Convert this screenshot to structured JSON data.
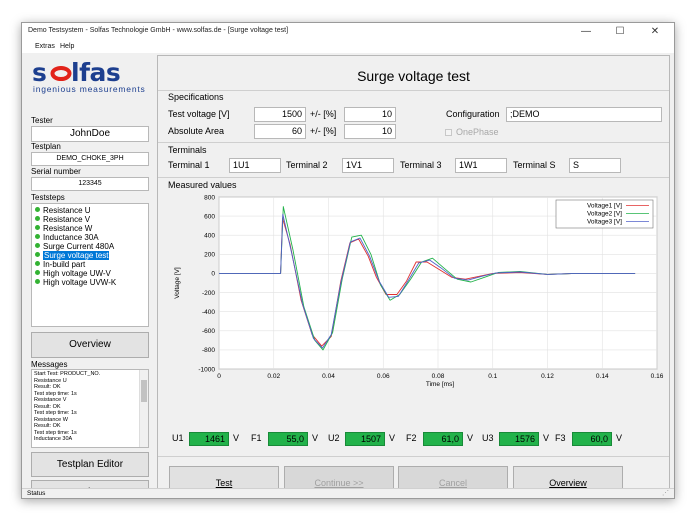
{
  "window": {
    "title": "Demo Testsystem - Solfas Technologie GmbH - www.solfas.de - [Surge voltage test]",
    "min_glyph": "—",
    "max_glyph": "☐",
    "close_glyph": "✕"
  },
  "menu": {
    "items": [
      "Extras",
      "Help"
    ]
  },
  "logo": {
    "brand": "solfas",
    "tagline": "ingenious measurements"
  },
  "tester": {
    "label": "Tester",
    "value": "JohnDoe"
  },
  "testplan": {
    "label": "Testplan",
    "value": "DEMO_CHOKE_3PH"
  },
  "serial": {
    "label": "Serial number",
    "value": "123345"
  },
  "teststeps": {
    "label": "Teststeps",
    "items": [
      "Resistance U",
      "Resistance V",
      "Resistance W",
      "Inductance 30A",
      "Surge Current 480A",
      "Surge voltage test",
      "In-build part",
      "High voltage UW-V",
      "High voltage UVW-K"
    ],
    "selected_index": 5
  },
  "overview_side_label": "Overview",
  "messages": {
    "label": "Messages",
    "lines": [
      "Start Test: PRODUCT_NO.",
      "Resistance U",
      "Result: OK",
      "Test step time: 1s",
      "Resistance V",
      "Result: OK",
      "Test step time: 1s",
      "Resistance W",
      "Result: OK",
      "Test step time: 1s",
      "Inductance 30A"
    ]
  },
  "side_buttons": {
    "testplan_editor": "Testplan Editor",
    "hardcopy": "Hardcopy"
  },
  "status": "Status",
  "main": {
    "title": "Surge voltage test",
    "specs": {
      "label": "Specifications",
      "test_voltage_label": "Test voltage [V]",
      "test_voltage_value": "1500",
      "tol_label_1": "+/- [%]",
      "tol_value_1": "10",
      "absolute_area_label": "Absolute Area",
      "absolute_area_value": "60",
      "tol_label_2": "+/- [%]",
      "tol_value_2": "10",
      "configuration_label": "Configuration",
      "configuration_value": ";DEMO",
      "onephase_label": "OnePhase",
      "onephase_checked": false
    },
    "terminals": {
      "label": "Terminals",
      "items": [
        {
          "label": "Terminal 1",
          "value": "1U1"
        },
        {
          "label": "Terminal 2",
          "value": "1V1"
        },
        {
          "label": "Terminal 3",
          "value": "1W1"
        },
        {
          "label": "Terminal S",
          "value": "S"
        }
      ]
    },
    "measured_label": "Measured values",
    "results": [
      {
        "label": "U1",
        "value": "1461",
        "unit": "V"
      },
      {
        "label": "F1",
        "value": "55,0",
        "unit": "V"
      },
      {
        "label": "U2",
        "value": "1507",
        "unit": "V"
      },
      {
        "label": "F2",
        "value": "61,0",
        "unit": "V"
      },
      {
        "label": "U3",
        "value": "1576",
        "unit": "V"
      },
      {
        "label": "F3",
        "value": "60,0",
        "unit": "V"
      }
    ],
    "buttons": [
      {
        "label": "Test",
        "enabled": true
      },
      {
        "label": "Continue >>",
        "enabled": false
      },
      {
        "label": "Cancel",
        "enabled": false
      },
      {
        "label": "Overview",
        "enabled": true
      }
    ]
  },
  "colors": {
    "logo_blue": "#1d3f8f",
    "logo_red": "#e2231a",
    "result_green": "#22b24a",
    "selection_blue": "#0078d7",
    "series1": "#e03030",
    "series2": "#22b24a",
    "series3": "#5060c8"
  },
  "chart_data": {
    "type": "line",
    "xlabel": "Time [ms]",
    "ylabel": "Voltage [V]",
    "xlim": [
      0,
      0.16
    ],
    "ylim": [
      -1000,
      800
    ],
    "xticks": [
      "0",
      "0.02",
      "0.04",
      "0.06",
      "0.08",
      "0.1",
      "0.12",
      "0.14",
      "0.16"
    ],
    "yticks": [
      "800",
      "600",
      "400",
      "200",
      "0",
      "-200",
      "-400",
      "-600",
      "-800",
      "-1000"
    ],
    "grid": true,
    "legend_position": "top-right",
    "series": [
      {
        "name": "Voltage1 [V]",
        "color": "#e03030",
        "x": [
          0,
          0.021,
          0.0225,
          0.0232,
          0.026,
          0.03,
          0.034,
          0.0375,
          0.041,
          0.0445,
          0.0478,
          0.051,
          0.0545,
          0.0575,
          0.061,
          0.065,
          0.0685,
          0.072,
          0.076,
          0.08,
          0.085,
          0.09,
          0.095,
          0.1,
          0.11,
          0.12,
          0.13,
          0.14,
          0.152
        ],
        "y": [
          0,
          0,
          0,
          580,
          300,
          -280,
          -640,
          -760,
          -660,
          -80,
          320,
          360,
          180,
          -40,
          -220,
          -220,
          -80,
          120,
          120,
          50,
          -40,
          -60,
          -30,
          0,
          10,
          -10,
          0,
          0,
          0
        ]
      },
      {
        "name": "Voltage2 [V]",
        "color": "#22b24a",
        "x": [
          0,
          0.021,
          0.0225,
          0.0235,
          0.027,
          0.031,
          0.035,
          0.038,
          0.0415,
          0.045,
          0.0485,
          0.052,
          0.0555,
          0.059,
          0.0625,
          0.066,
          0.07,
          0.074,
          0.078,
          0.082,
          0.087,
          0.092,
          0.097,
          0.102,
          0.11,
          0.12,
          0.13,
          0.14,
          0.152
        ],
        "y": [
          0,
          0,
          0,
          700,
          250,
          -350,
          -700,
          -800,
          -620,
          -60,
          380,
          400,
          200,
          -120,
          -280,
          -220,
          -60,
          120,
          160,
          60,
          -60,
          -90,
          -40,
          10,
          20,
          -10,
          0,
          0,
          0
        ]
      },
      {
        "name": "Voltage3 [V]",
        "color": "#5060c8",
        "x": [
          0,
          0.021,
          0.0225,
          0.0233,
          0.0265,
          0.0305,
          0.0345,
          0.0378,
          0.041,
          0.0445,
          0.048,
          0.0515,
          0.055,
          0.0585,
          0.062,
          0.0655,
          0.069,
          0.073,
          0.077,
          0.081,
          0.086,
          0.091,
          0.096,
          0.101,
          0.11,
          0.12,
          0.13,
          0.14,
          0.152
        ],
        "y": [
          0,
          0,
          0,
          620,
          220,
          -320,
          -680,
          -780,
          -640,
          -100,
          330,
          370,
          180,
          -80,
          -250,
          -240,
          -80,
          110,
          140,
          60,
          -50,
          -70,
          -30,
          5,
          15,
          -10,
          0,
          0,
          0
        ]
      }
    ]
  }
}
